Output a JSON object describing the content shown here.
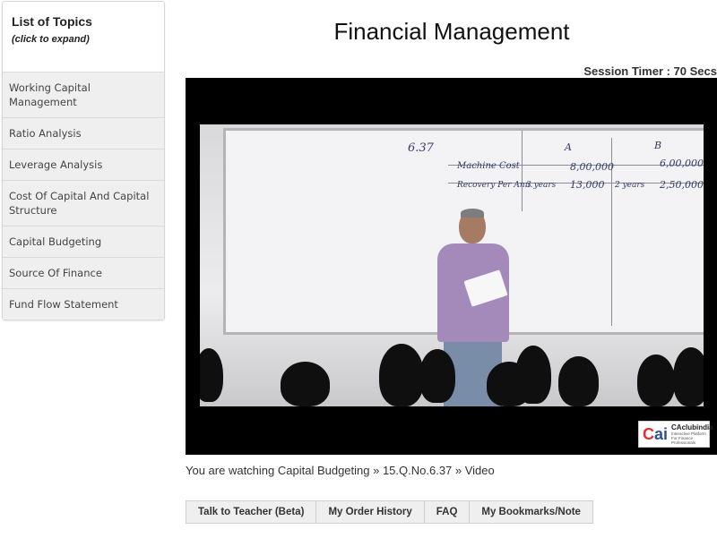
{
  "sidebar": {
    "title": "List of Topics",
    "subtitle": "(click to expand)",
    "items": [
      {
        "label": "Working Capital Management"
      },
      {
        "label": "Ratio Analysis"
      },
      {
        "label": "Leverage Analysis"
      },
      {
        "label": "Cost Of Capital And Capital Structure"
      },
      {
        "label": "Capital Budgeting"
      },
      {
        "label": "Source Of Finance"
      },
      {
        "label": "Fund Flow Statement"
      }
    ]
  },
  "main": {
    "title": "Financial Management",
    "timer": "Session Timer : 70 Secs",
    "breadcrumb": "You are watching Capital Budgeting » 15.Q.No.6.37 » Video"
  },
  "video": {
    "board": {
      "q_no": "6.37",
      "col_a": "A",
      "col_b": "B",
      "row1_label": "Machine Cost",
      "row1_a": "8,00,000",
      "row1_b": "6,00,000",
      "row2_label": "Recovery Per Ann.",
      "row2_years_a": "3 years",
      "row2_a": "13,000",
      "row2_years_b": "2 years",
      "row2_b": "2,50,000"
    },
    "logo": {
      "mark_c": "C",
      "mark_ai": "ai",
      "name": "CAclubindia",
      "tagline_1": "Interactive Platform",
      "tagline_2": "For Finance Professionals"
    }
  },
  "buttons": [
    {
      "label": "Talk to Teacher (Beta)"
    },
    {
      "label": "My Order History"
    },
    {
      "label": "FAQ"
    },
    {
      "label": "My Bookmarks/Note"
    }
  ]
}
